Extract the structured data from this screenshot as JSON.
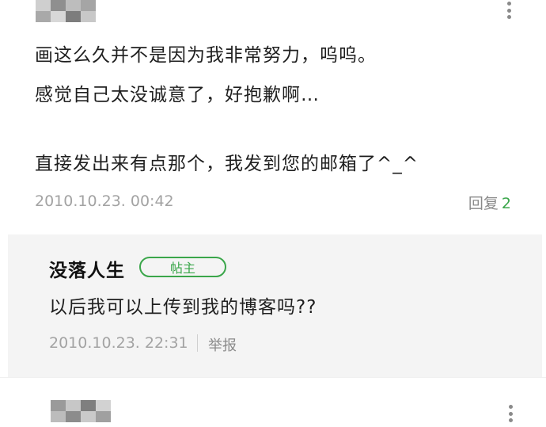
{
  "post": {
    "lines": [
      "画这么久并不是因为我非常努力，呜呜。",
      "感觉自己太没诚意了，好抱歉啊…",
      "直接发出来有点那个，我发到您的邮箱了^_^"
    ],
    "timestamp": "2010.10.23. 00:42",
    "reply_label": "回复",
    "reply_count": "2"
  },
  "reply": {
    "author": "没落人生",
    "badge": "帖主",
    "text": "以后我可以上传到我的博客吗??",
    "timestamp": "2010.10.23. 22:31",
    "report_label": "举报"
  },
  "icons": {
    "more": "more-vertical-icon"
  },
  "colors": {
    "accent": "#3aa64a",
    "reply_bg": "#f4f4f4"
  }
}
